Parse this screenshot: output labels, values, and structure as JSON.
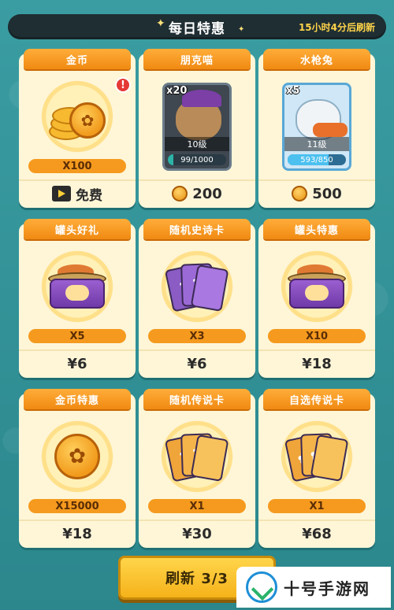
{
  "header": {
    "title": "每日特惠",
    "refresh_timer": "15小时4分后刷新"
  },
  "cards": [
    {
      "title": "金币",
      "art": "coin-stack",
      "quantity": "X100",
      "price_icon": "video-icon",
      "price": "免费",
      "alert": "!"
    },
    {
      "title": "朋克喵",
      "art": "hero-punk-cat",
      "count": "x20",
      "level": "10级",
      "progress_text": "99/1000",
      "progress": 0.099,
      "price_icon": "coin-icon",
      "price": "200"
    },
    {
      "title": "水枪兔",
      "art": "hero-water-rabbit",
      "count": "x5",
      "level": "11级",
      "progress_text": "593/850",
      "progress": 0.698,
      "price_icon": "coin-icon",
      "price": "500"
    },
    {
      "title": "罐头好礼",
      "art": "can",
      "quantity": "X5",
      "price": "¥6"
    },
    {
      "title": "随机史诗卡",
      "art": "epic-cards",
      "quantity": "X3",
      "price": "¥6"
    },
    {
      "title": "罐头特惠",
      "art": "can",
      "quantity": "X10",
      "price": "¥18"
    },
    {
      "title": "金币特惠",
      "art": "big-coin",
      "quantity": "X15000",
      "price": "¥18"
    },
    {
      "title": "随机传说卡",
      "art": "legend-cards",
      "quantity": "X1",
      "price": "¥30"
    },
    {
      "title": "自选传说卡",
      "art": "legend-paw-cards",
      "quantity": "X1",
      "price": "¥68"
    }
  ],
  "refresh_button": {
    "label": "刷新 3/3"
  },
  "watermark": {
    "text": "十号手游网"
  },
  "colors": {
    "background": "#2f8f95",
    "tab_orange": "#f08a12",
    "card_bg": "#fff6d8",
    "qty_bar": "#f59a1e",
    "timer": "#ffd44a",
    "button_yellow": "#f5b21a"
  }
}
